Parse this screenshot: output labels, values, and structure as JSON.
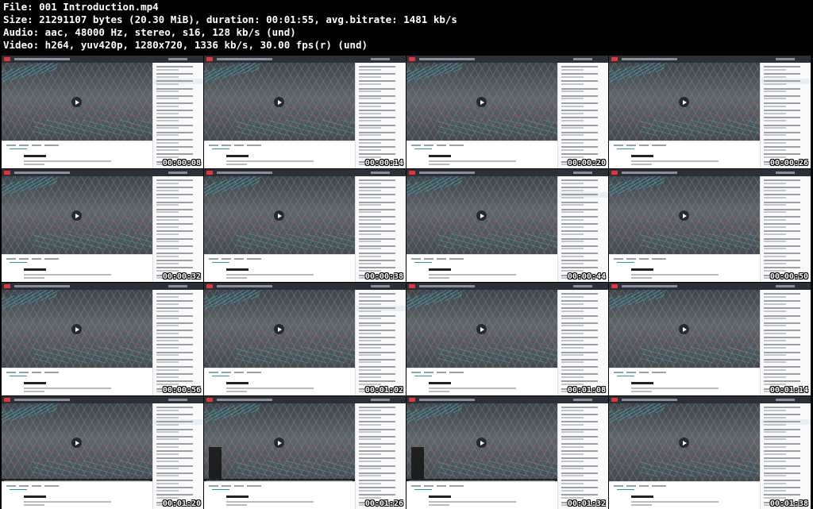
{
  "header": {
    "file": "File: 001 Introduction.mp4",
    "size": "Size: 21291107 bytes (20.30 MiB), duration: 00:01:55, avg.bitrate: 1481 kb/s",
    "audio": "Audio: aac, 48000 Hz, stereo, s16, 128 kb/s (und)",
    "video": "Video: h264, yuv420p, 1280x720, 1336 kb/s, 30.00 fps(r) (und)"
  },
  "thumbnails": [
    {
      "timestamp": "00:00:08"
    },
    {
      "timestamp": "00:00:14"
    },
    {
      "timestamp": "00:00:20"
    },
    {
      "timestamp": "00:00:26"
    },
    {
      "timestamp": "00:00:32"
    },
    {
      "timestamp": "00:00:38"
    },
    {
      "timestamp": "00:00:44"
    },
    {
      "timestamp": "00:00:50"
    },
    {
      "timestamp": "00:00:56"
    },
    {
      "timestamp": "00:01:02"
    },
    {
      "timestamp": "00:01:08"
    },
    {
      "timestamp": "00:01:14"
    },
    {
      "timestamp": "00:01:20"
    },
    {
      "timestamp": "00:01:26"
    },
    {
      "timestamp": "00:01:32"
    },
    {
      "timestamp": "00:01:38"
    }
  ],
  "colors": {
    "background": "#000000",
    "accent_teal": "#1e9ba7",
    "brand_red": "#e2363f",
    "player_bar": "#2b2f36"
  }
}
